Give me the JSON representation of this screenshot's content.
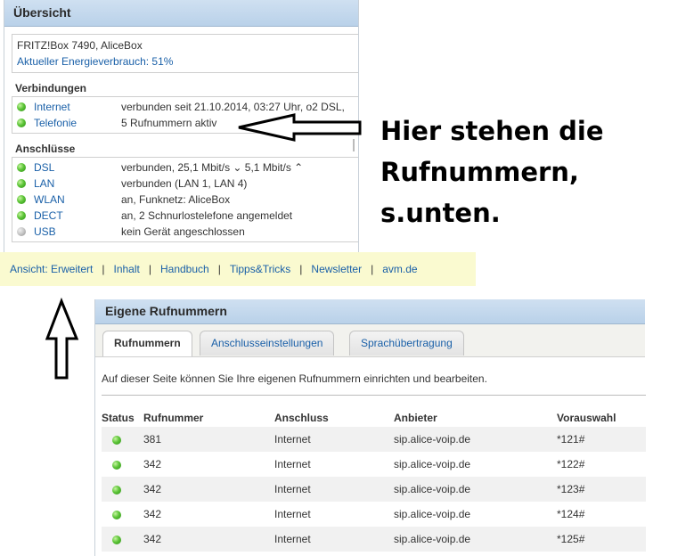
{
  "overview": {
    "title": "Übersicht",
    "device": "FRITZ!Box 7490, AliceBox",
    "energy": "Aktueller Energieverbrauch: 51%",
    "connections_title": "Verbindungen",
    "connections": [
      {
        "name": "Internet",
        "value": "verbunden seit 21.10.2014, 03:27 Uhr, o2 DSL,",
        "status": "green"
      },
      {
        "name": "Telefonie",
        "value": "5 Rufnummern aktiv",
        "status": "green"
      }
    ],
    "ports_title": "Anschlüsse",
    "ports": [
      {
        "name": "DSL",
        "value": "verbunden, 25,1 Mbit/s ⌄ 5,1 Mbit/s ⌃",
        "status": "green"
      },
      {
        "name": "LAN",
        "value": "verbunden (LAN 1, LAN 4)",
        "status": "green"
      },
      {
        "name": "WLAN",
        "value": "an, Funknetz: AliceBox",
        "status": "green"
      },
      {
        "name": "DECT",
        "value": "an, 2 Schnurlostelefone angemeldet",
        "status": "green"
      },
      {
        "name": "USB",
        "value": "kein Gerät angeschlossen",
        "status": "grey"
      }
    ]
  },
  "footer": {
    "links": [
      "Ansicht: Erweitert",
      "Inhalt",
      "Handbuch",
      "Tipps&Tricks",
      "Newsletter",
      "avm.de"
    ],
    "separator": "|"
  },
  "annotation": {
    "line1": "Hier stehen die",
    "line2": "Rufnummern, s.unten."
  },
  "numbers_panel": {
    "title": "Eigene Rufnummern",
    "tabs": [
      "Rufnummern",
      "Anschlusseinstellungen",
      "Sprachübertragung"
    ],
    "active_tab": "Rufnummern",
    "intro": "Auf dieser Seite können Sie Ihre eigenen Rufnummern einrichten und bearbeiten.",
    "columns": [
      "Status",
      "Rufnummer",
      "Anschluss",
      "Anbieter",
      "Vorauswahl"
    ],
    "rows": [
      {
        "number": "381",
        "connection": "Internet",
        "provider": "sip.alice-voip.de",
        "preselect": "*121#"
      },
      {
        "number": "342",
        "connection": "Internet",
        "provider": "sip.alice-voip.de",
        "preselect": "*122#"
      },
      {
        "number": "342",
        "connection": "Internet",
        "provider": "sip.alice-voip.de",
        "preselect": "*123#"
      },
      {
        "number": "342",
        "connection": "Internet",
        "provider": "sip.alice-voip.de",
        "preselect": "*124#"
      },
      {
        "number": "342",
        "connection": "Internet",
        "provider": "sip.alice-voip.de",
        "preselect": "*125#"
      }
    ]
  },
  "colors": {
    "header_blue": "#c4d9ee",
    "link_blue": "#1a60a8",
    "footer_yellow": "#fafad0",
    "status_green": "#4fbf2e"
  }
}
